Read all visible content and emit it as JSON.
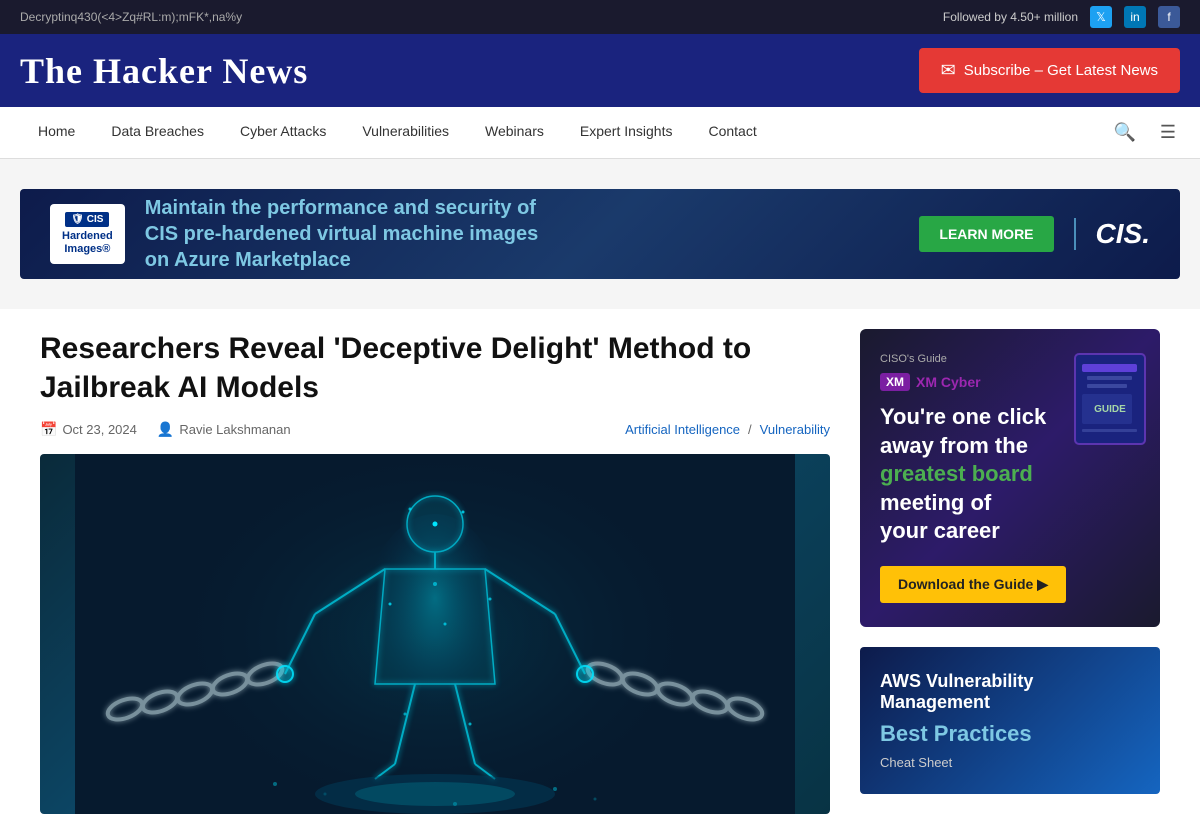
{
  "topbar": {
    "marquee_text": "Decryptinq430(<4>Zq#RL:m);mFK*,na%y",
    "followers_text": "Followed by 4.50+ million"
  },
  "header": {
    "logo": "The Hacker News",
    "subscribe_btn": "Subscribe – Get Latest News"
  },
  "nav": {
    "links": [
      {
        "label": "Home",
        "id": "home"
      },
      {
        "label": "Data Breaches",
        "id": "data-breaches"
      },
      {
        "label": "Cyber Attacks",
        "id": "cyber-attacks"
      },
      {
        "label": "Vulnerabilities",
        "id": "vulnerabilities"
      },
      {
        "label": "Webinars",
        "id": "webinars"
      },
      {
        "label": "Expert Insights",
        "id": "expert-insights"
      },
      {
        "label": "Contact",
        "id": "contact"
      }
    ]
  },
  "ad_banner": {
    "cis_badge": "CIS",
    "cis_label": "Hardened\nImages®",
    "text_line1": "Maintain the performance and security of",
    "text_line2": "CIS pre-hardened virtual machine images",
    "text_line3": "on Azure Marketplace",
    "learn_more_btn": "LEARN MORE",
    "right_logo": "CIS."
  },
  "article": {
    "title": "Researchers Reveal 'Deceptive Delight' Method to Jailbreak AI Models",
    "date": "Oct 23, 2024",
    "author": "Ravie Lakshmanan",
    "category1": "Artificial Intelligence",
    "category_sep": "/",
    "category2": "Vulnerability"
  },
  "sidebar": {
    "xm_cyber": {
      "badge": "XM Cyber",
      "guide_label": "CISO's Guide",
      "headline_line1": "You're one click",
      "headline_line2": "away from the",
      "headline_green": "greatest board",
      "headline_line3": "meeting of",
      "headline_line4": "your career",
      "download_btn": "Download the Guide ▶"
    },
    "aws": {
      "title": "AWS Vulnerability Management",
      "subtitle": "Best Practices",
      "label": "Cheat Sheet"
    }
  },
  "icons": {
    "twitter": "𝕏",
    "linkedin": "in",
    "facebook": "f",
    "search": "🔍",
    "menu": "☰",
    "envelope": "✉",
    "calendar": "📅",
    "user": "👤"
  }
}
